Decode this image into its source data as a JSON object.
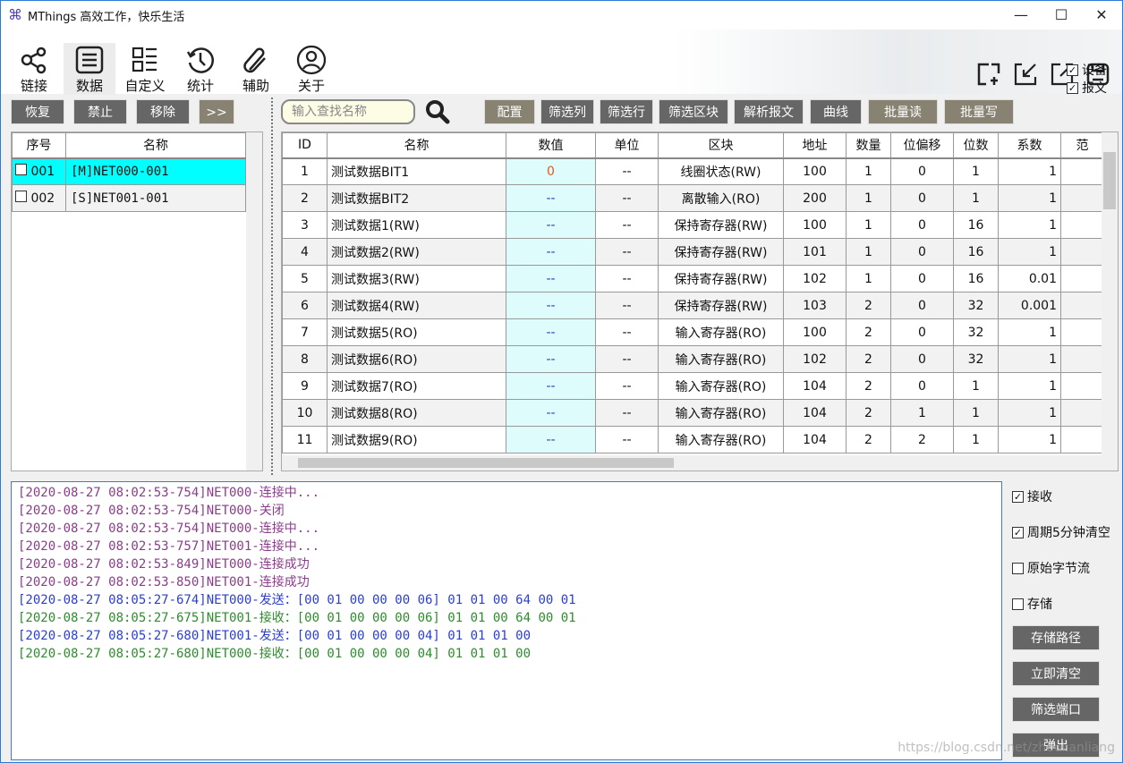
{
  "window": {
    "title": "MThings  高效工作，快乐生活",
    "minimize": "—",
    "maximize": "☐",
    "close": "✕"
  },
  "toolbar": {
    "items": [
      {
        "label": "链接",
        "icon": "share-icon"
      },
      {
        "label": "数据",
        "icon": "list-icon",
        "active": true
      },
      {
        "label": "自定义",
        "icon": "custom-layout-icon"
      },
      {
        "label": "统计",
        "icon": "history-icon"
      },
      {
        "label": "辅助",
        "icon": "paperclip-icon"
      },
      {
        "label": "关于",
        "icon": "user-icon"
      }
    ],
    "right_icons": [
      "add-window-icon",
      "dock-in-icon",
      "pop-out-icon",
      "save-icon"
    ],
    "checks": [
      {
        "label": "设备",
        "checked": true
      },
      {
        "label": "报文",
        "checked": true
      }
    ]
  },
  "left": {
    "buttons": [
      "恢复",
      "禁止",
      "移除",
      ">>"
    ],
    "headers": [
      "序号",
      "名称"
    ],
    "rows": [
      {
        "no": "001",
        "name": "[M]NET000-001",
        "selected": true
      },
      {
        "no": "002",
        "name": "[S]NET001-001",
        "selected": false
      }
    ]
  },
  "search": {
    "placeholder": "输入查找名称"
  },
  "actions": [
    "配置",
    "筛选列",
    "筛选行",
    "筛选区块",
    "解析报文",
    "曲线",
    "批量读",
    "批量写"
  ],
  "table": {
    "headers": [
      "ID",
      "名称",
      "数值",
      "单位",
      "区块",
      "地址",
      "数量",
      "位偏移",
      "位数",
      "系数",
      "范"
    ],
    "rows": [
      [
        "1",
        "测试数据BIT1",
        "0",
        "--",
        "线圈状态(RW)",
        "100",
        "1",
        "0",
        "1",
        "1"
      ],
      [
        "2",
        "测试数据BIT2",
        "--",
        "--",
        "离散输入(RO)",
        "200",
        "1",
        "0",
        "1",
        "1"
      ],
      [
        "3",
        "测试数据1(RW)",
        "--",
        "--",
        "保持寄存器(RW)",
        "100",
        "1",
        "0",
        "16",
        "1"
      ],
      [
        "4",
        "测试数据2(RW)",
        "--",
        "--",
        "保持寄存器(RW)",
        "101",
        "1",
        "0",
        "16",
        "1"
      ],
      [
        "5",
        "测试数据3(RW)",
        "--",
        "--",
        "保持寄存器(RW)",
        "102",
        "1",
        "0",
        "16",
        "0.01"
      ],
      [
        "6",
        "测试数据4(RW)",
        "--",
        "--",
        "保持寄存器(RW)",
        "103",
        "2",
        "0",
        "32",
        "0.001"
      ],
      [
        "7",
        "测试数据5(RO)",
        "--",
        "--",
        "输入寄存器(RO)",
        "100",
        "2",
        "0",
        "32",
        "1"
      ],
      [
        "8",
        "测试数据6(RO)",
        "--",
        "--",
        "输入寄存器(RO)",
        "102",
        "2",
        "0",
        "32",
        "1"
      ],
      [
        "9",
        "测试数据7(RO)",
        "--",
        "--",
        "输入寄存器(RO)",
        "104",
        "2",
        "0",
        "1",
        "1"
      ],
      [
        "10",
        "测试数据8(RO)",
        "--",
        "--",
        "输入寄存器(RO)",
        "104",
        "2",
        "1",
        "1",
        "1"
      ],
      [
        "11",
        "测试数据9(RO)",
        "--",
        "--",
        "输入寄存器(RO)",
        "104",
        "2",
        "2",
        "1",
        "1"
      ]
    ]
  },
  "log": {
    "lines": [
      {
        "ts": "[2020-08-27 08:02:53-754]",
        "msg": "NET000-连接中...",
        "color": "#8a3d8a"
      },
      {
        "ts": "[2020-08-27 08:02:53-754]",
        "msg": "NET000-关闭",
        "color": "#8a3d8a"
      },
      {
        "ts": "[2020-08-27 08:02:53-754]",
        "msg": "NET000-连接中...",
        "color": "#8a3d8a"
      },
      {
        "ts": "[2020-08-27 08:02:53-757]",
        "msg": "NET001-连接中...",
        "color": "#8a3d8a"
      },
      {
        "ts": "[2020-08-27 08:02:53-849]",
        "msg": "NET000-连接成功",
        "color": "#8a3d8a"
      },
      {
        "ts": "[2020-08-27 08:02:53-850]",
        "msg": "NET001-连接成功",
        "color": "#8a3d8a"
      },
      {
        "ts": "[2020-08-27 08:05:27-674]",
        "msg": "NET000-发送：[00 01 00 00 00 06] 01 01 00 64 00 01",
        "color": "#2a3fd0"
      },
      {
        "ts": "[2020-08-27 08:05:27-675]",
        "msg": "NET001-接收：[00 01 00 00 00 06] 01 01 00 64 00 01",
        "color": "#2e8b2e"
      },
      {
        "ts": "[2020-08-27 08:05:27-680]",
        "msg": "NET001-发送：[00 01 00 00 00 04] 01 01 01 00",
        "color": "#2a3fd0"
      },
      {
        "ts": "[2020-08-27 08:05:27-680]",
        "msg": "NET000-接收：[00 01 00 00 00 04] 01 01 01 00",
        "color": "#2e8b2e"
      }
    ]
  },
  "log_options": {
    "checks": [
      {
        "label": "接收",
        "checked": true
      },
      {
        "label": "周期5分钟清空",
        "checked": true
      },
      {
        "label": "原始字节流",
        "checked": false
      },
      {
        "label": "存储",
        "checked": false
      }
    ],
    "buttons": [
      "存储路径",
      "立即清空",
      "筛选端口",
      "弹出"
    ]
  },
  "watermark": "https://blog.csdn.net/zhoulianliang",
  "colors": {
    "selected_row": "#00ffff",
    "value_cell": "#dffcfc",
    "value_zero": "#e05a1c",
    "button": "#666666",
    "button_olive": "#878271"
  }
}
